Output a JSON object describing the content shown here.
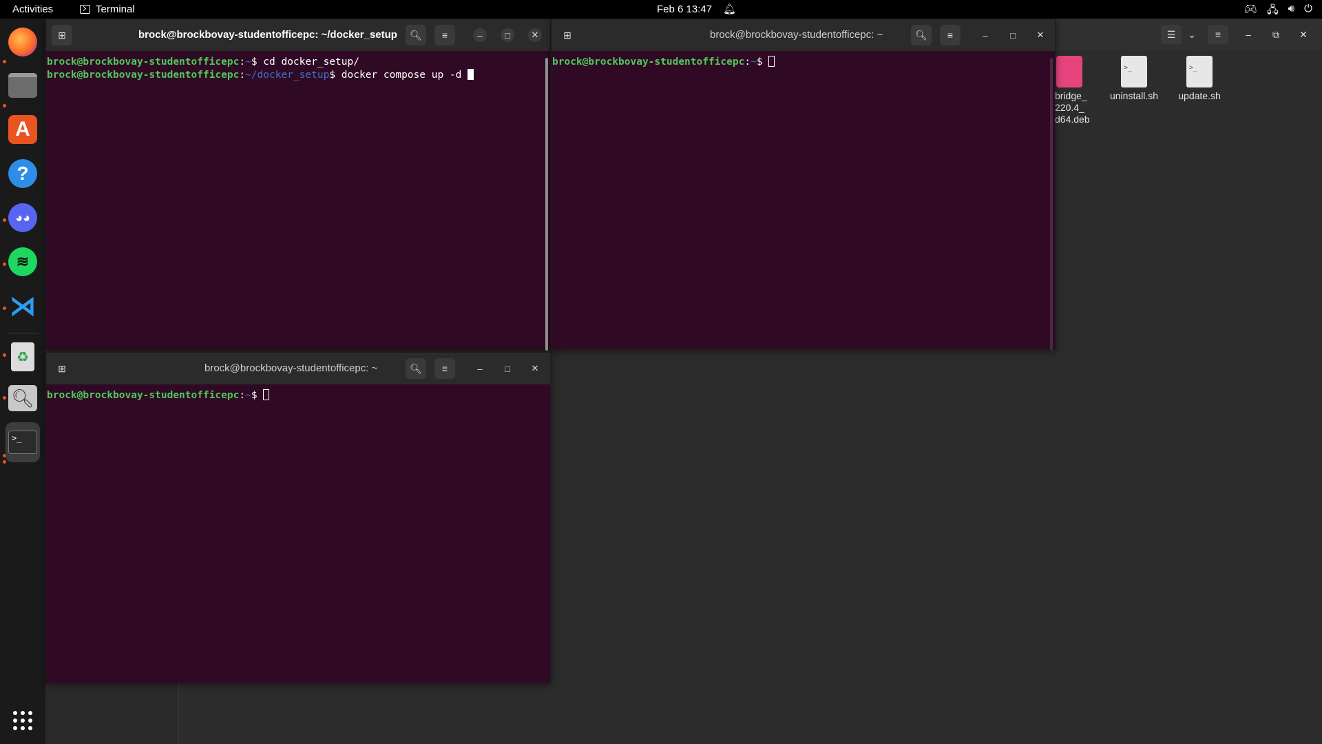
{
  "topbar": {
    "activities": "Activities",
    "app_name": "Terminal",
    "clock": "Feb 6  13:47"
  },
  "dock": {
    "apps": [
      "firefox",
      "files",
      "app-center",
      "help",
      "discord",
      "spotify",
      "vscode",
      "trash",
      "image-viewer",
      "terminal"
    ]
  },
  "terminals": {
    "top_left": {
      "title": "brock@brockbovay-studentofficepc: ~/docker_setup",
      "lines": [
        {
          "user": "brock@brockbovay-studentofficepc",
          "path": "~",
          "cmd": "$ cd docker_setup/"
        },
        {
          "user": "brock@brockbovay-studentofficepc",
          "path": "~/docker_setup",
          "cmd": "$ docker compose up -d "
        }
      ]
    },
    "top_right": {
      "title": "brock@brockbovay-studentofficepc: ~",
      "lines": [
        {
          "user": "brock@brockbovay-studentofficepc",
          "path": "~",
          "cmd": "$ "
        }
      ]
    },
    "bottom": {
      "title": "brock@brockbovay-studentofficepc: ~",
      "lines": [
        {
          "user": "brock@brockbovay-studentofficepc",
          "path": "~",
          "cmd": "$ "
        }
      ]
    }
  },
  "file_manager": {
    "files": [
      {
        "name": "bridge_\n220.4_\nd64.deb",
        "type": "deb"
      },
      {
        "name": "uninstall.sh",
        "type": "script"
      },
      {
        "name": "update.sh",
        "type": "script"
      }
    ]
  },
  "colors": {
    "terminal_bg": "#300a24",
    "prompt_user": "#4fc85c",
    "prompt_path": "#3f6fd0",
    "accent": "#e95420"
  }
}
